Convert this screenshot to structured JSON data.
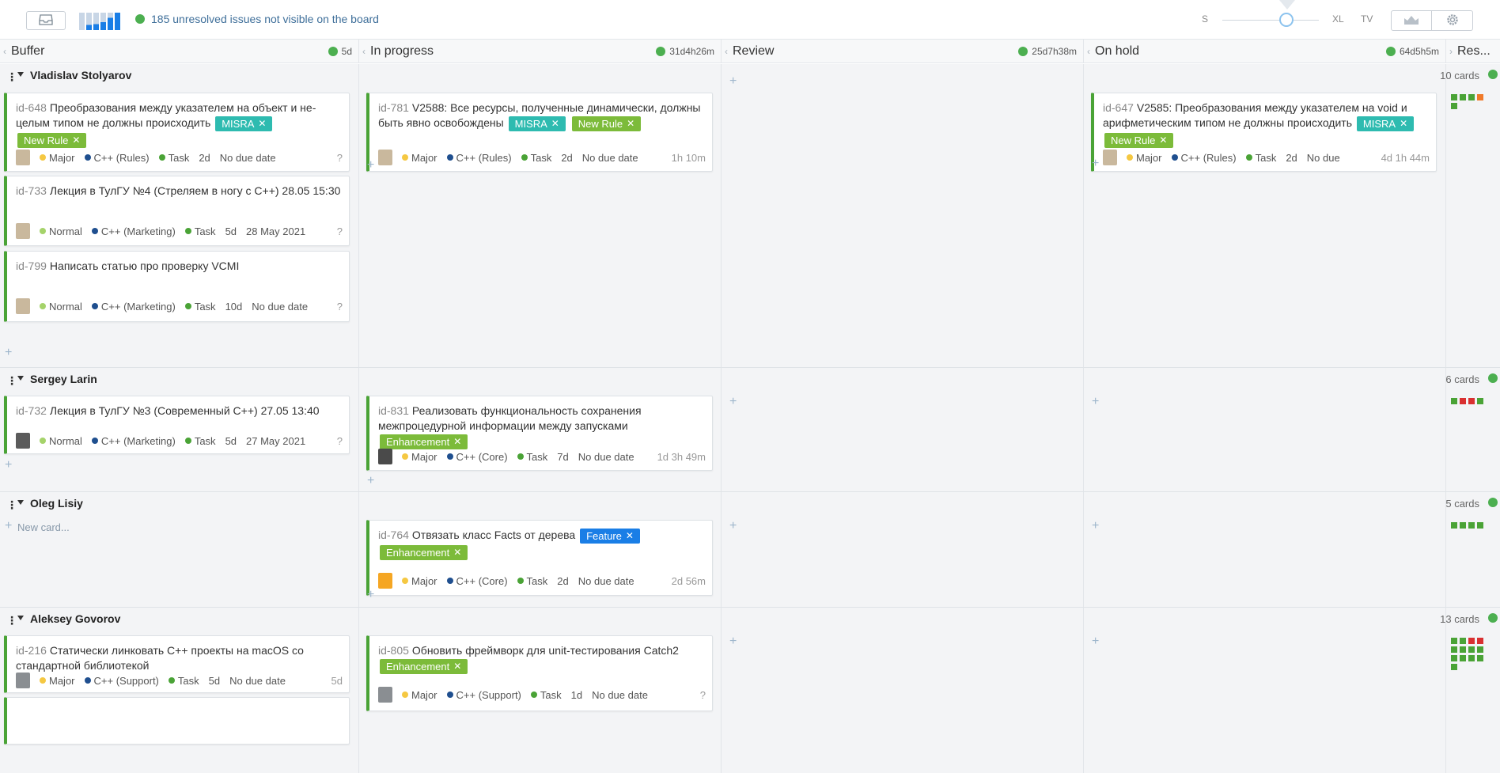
{
  "toolbar": {
    "unresolved_text": "185 unresolved issues not visible on the board",
    "size_s": "S",
    "size_xl": "XL",
    "size_tv": "TV"
  },
  "columns": [
    {
      "name": "Buffer",
      "time": "5d"
    },
    {
      "name": "In progress",
      "time": "31d4h26m"
    },
    {
      "name": "Review",
      "time": "25d7h38m"
    },
    {
      "name": "On hold",
      "time": "64d5h5m"
    },
    {
      "name": "Res..."
    }
  ],
  "colors": {
    "green": "#4aa336",
    "misra": "#2ebbb0",
    "new_rule": "#7cbb3a",
    "enhancement": "#7cbb3a",
    "feature": "#1a7ee6",
    "major": "#f5c842",
    "normal": "#a5d36a",
    "rules_dot": "#1f4f8f",
    "task_dot": "#4aa336",
    "red": "#d93030",
    "orange": "#f07a2a"
  },
  "lanes": [
    {
      "name": "Vladislav Stolyarov",
      "count": "10 cards",
      "cards": [
        {
          "id": "id-648",
          "title": "Преобразования между указателем на объект и не-целым типом не должны происходить",
          "tag1": "MISRA",
          "tag2": "New Rule",
          "priority": "Major",
          "subsystem": "C++ (Rules)",
          "type": "Task",
          "estimate": "2d",
          "due": "No due date",
          "extra": "?"
        },
        {
          "id": "id-733",
          "title": "Лекция в ТулГУ №4 (Стреляем в ногу с C++) 28.05 15:30",
          "priority": "Normal",
          "subsystem": "C++ (Marketing)",
          "type": "Task",
          "estimate": "5d",
          "due": "28 May 2021",
          "extra": "?"
        },
        {
          "id": "id-799",
          "title": "Написать статью про проверку VCMI",
          "priority": "Normal",
          "subsystem": "C++ (Marketing)",
          "type": "Task",
          "estimate": "10d",
          "due": "No due date",
          "extra": "?"
        },
        {
          "id": "id-781",
          "title": "V2588: Все ресурсы, полученные динамически, должны быть явно освобождены",
          "tag1": "MISRA",
          "tag2": "New Rule",
          "priority": "Major",
          "subsystem": "C++ (Rules)",
          "type": "Task",
          "estimate": "2d",
          "due": "No due date",
          "extra": "1h 10m"
        },
        {
          "id": "id-647",
          "title": "V2585: Преобразования между указателем на void и арифметическим типом не должны происходить",
          "tag1": "MISRA",
          "tag2": "New Rule",
          "priority": "Major",
          "subsystem": "C++ (Rules)",
          "type": "Task",
          "estimate": "2d",
          "due": "No due",
          "extra": "4d 1h 44m"
        }
      ]
    },
    {
      "name": "Sergey Larin",
      "count": "6 cards",
      "cards": [
        {
          "id": "id-732",
          "title": "Лекция в ТулГУ №3 (Современный C++) 27.05 13:40",
          "priority": "Normal",
          "subsystem": "C++ (Marketing)",
          "type": "Task",
          "estimate": "5d",
          "due": "27 May 2021",
          "extra": "?"
        },
        {
          "id": "id-831",
          "title": "Реализовать функциональность сохранения межпроцедурной информации между запусками",
          "tag1": "Enhancement",
          "priority": "Major",
          "subsystem": "C++ (Core)",
          "type": "Task",
          "estimate": "7d",
          "due": "No due date",
          "extra": "1d 3h 49m"
        }
      ]
    },
    {
      "name": "Oleg Lisiy",
      "count": "5 cards",
      "new_card": "New card...",
      "cards": [
        {
          "id": "id-764",
          "title": "Отвязать класс Facts от дерева",
          "tag1": "Feature",
          "tag2": "Enhancement",
          "priority": "Major",
          "subsystem": "C++ (Core)",
          "type": "Task",
          "estimate": "2d",
          "due": "No due date",
          "extra": "2d 56m"
        }
      ]
    },
    {
      "name": "Aleksey Govorov",
      "count": "13 cards",
      "cards": [
        {
          "id": "id-216",
          "title": "Статически линковать C++ проекты на macOS со стандартной библиотекой",
          "priority": "Major",
          "subsystem": "C++ (Support)",
          "type": "Task",
          "estimate": "5d",
          "due": "No due date",
          "extra": "5d"
        },
        {
          "id": "id-805",
          "title": "Обновить фреймворк для unit-тестирования Catch2",
          "tag1": "Enhancement",
          "priority": "Major",
          "subsystem": "C++ (Support)",
          "type": "Task",
          "estimate": "1d",
          "due": "No due date",
          "extra": "?"
        }
      ]
    }
  ]
}
